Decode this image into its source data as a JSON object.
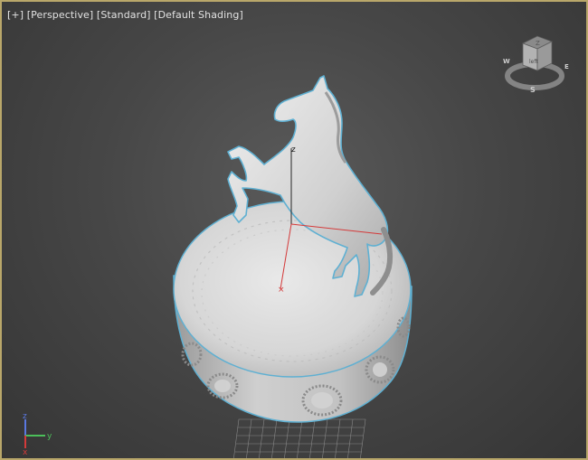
{
  "viewport": {
    "menu_label": "[+]",
    "view_label": "[Perspective]",
    "mode_label": "[Standard]",
    "shading_label": "[Default Shading]"
  },
  "viewcube": {
    "face_label": "left",
    "compass": {
      "south": "S",
      "west": "W",
      "east": "E"
    }
  },
  "gizmo": {
    "axis_label": "z"
  },
  "axis_tripod": {
    "z": "z",
    "x": "x",
    "y": "y"
  },
  "colors": {
    "frame_border": "#b9a76a",
    "selection_outline": "#5fb0d2",
    "axis_x": "#d43a3a",
    "axis_y": "#4cbf5a",
    "axis_z": "#5a78e0"
  }
}
